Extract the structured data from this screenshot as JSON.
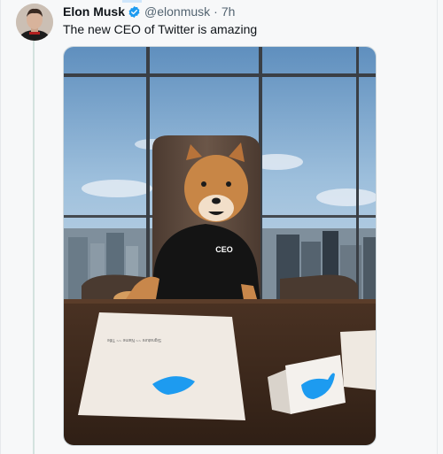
{
  "tweet": {
    "author_name": "Elon Musk",
    "handle": "@elonmusk",
    "separator": "·",
    "time": "7h",
    "text": "The new CEO of Twitter is amazing"
  },
  "media": {
    "shirt_text": "CEO",
    "accent_color": "#1d9bf0"
  },
  "icons": {
    "verified": "verified-badge-icon",
    "twitter_bird": "twitter-bird-icon"
  }
}
